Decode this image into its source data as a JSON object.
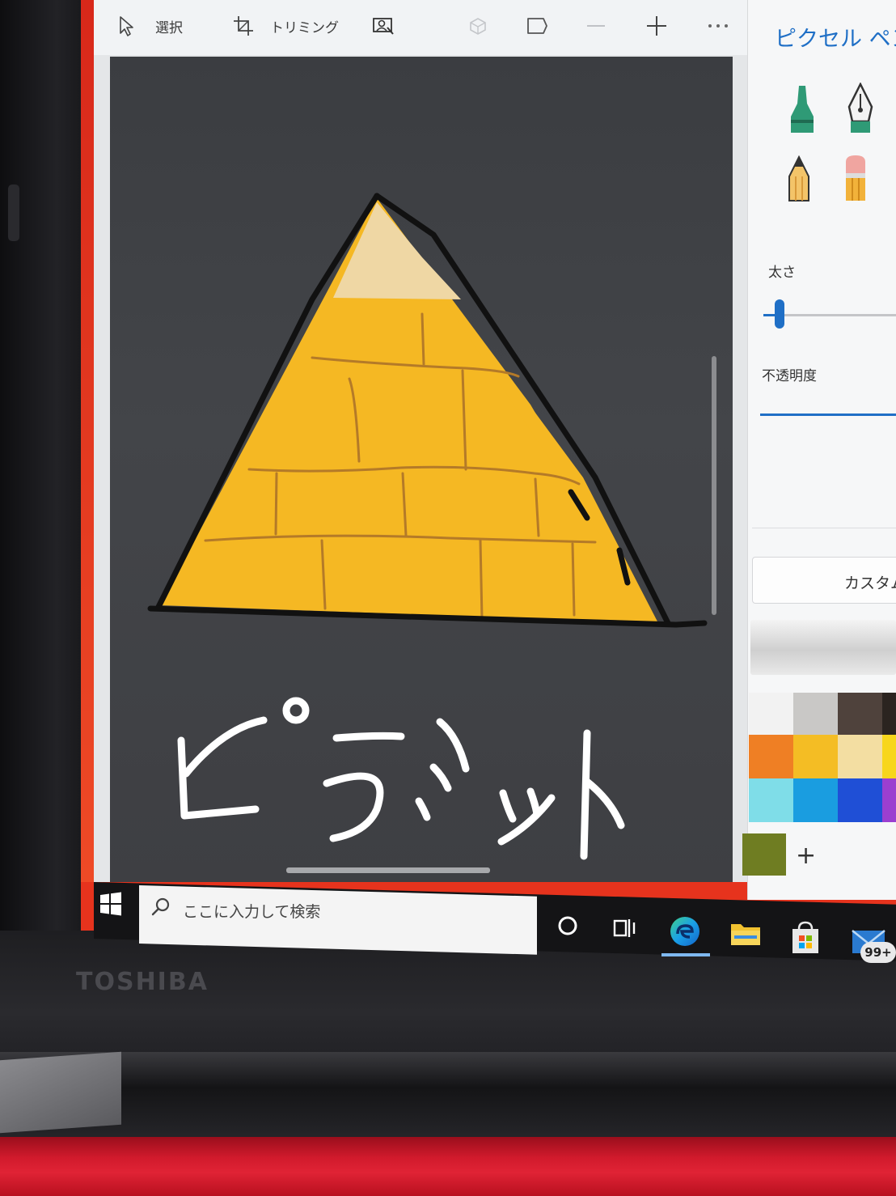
{
  "toolbar": {
    "select_label": "選択",
    "crop_label": "トリミング"
  },
  "panel": {
    "title": "ピクセル ペン",
    "size_label": "太さ",
    "opacity_label": "不透明度",
    "custom_label": "カスタム",
    "add_label": "+",
    "selected_size": 0.12,
    "palette": [
      [
        "#f2f2f2",
        "#c9c8c6",
        "#4f423c",
        "#2b2420"
      ],
      [
        "#ef7f24",
        "#f4bd24",
        "#f3dea2",
        "#f7d61c"
      ],
      [
        "#7fdde8",
        "#1a9de0",
        "#1f4fd6",
        "#9b3fd0"
      ]
    ],
    "custom_color": "#6f7d22"
  },
  "canvas": {
    "handwritten_text": "ピラミッド",
    "pyramid_colors": {
      "body": "#f5b823",
      "top": "#efd7a4",
      "lines": "#b47a28",
      "outline": "#111111"
    }
  },
  "taskbar": {
    "search_placeholder": "ここに入力して検索",
    "mail_badge": "99+"
  },
  "device": {
    "brand": "TOSHIBA"
  }
}
